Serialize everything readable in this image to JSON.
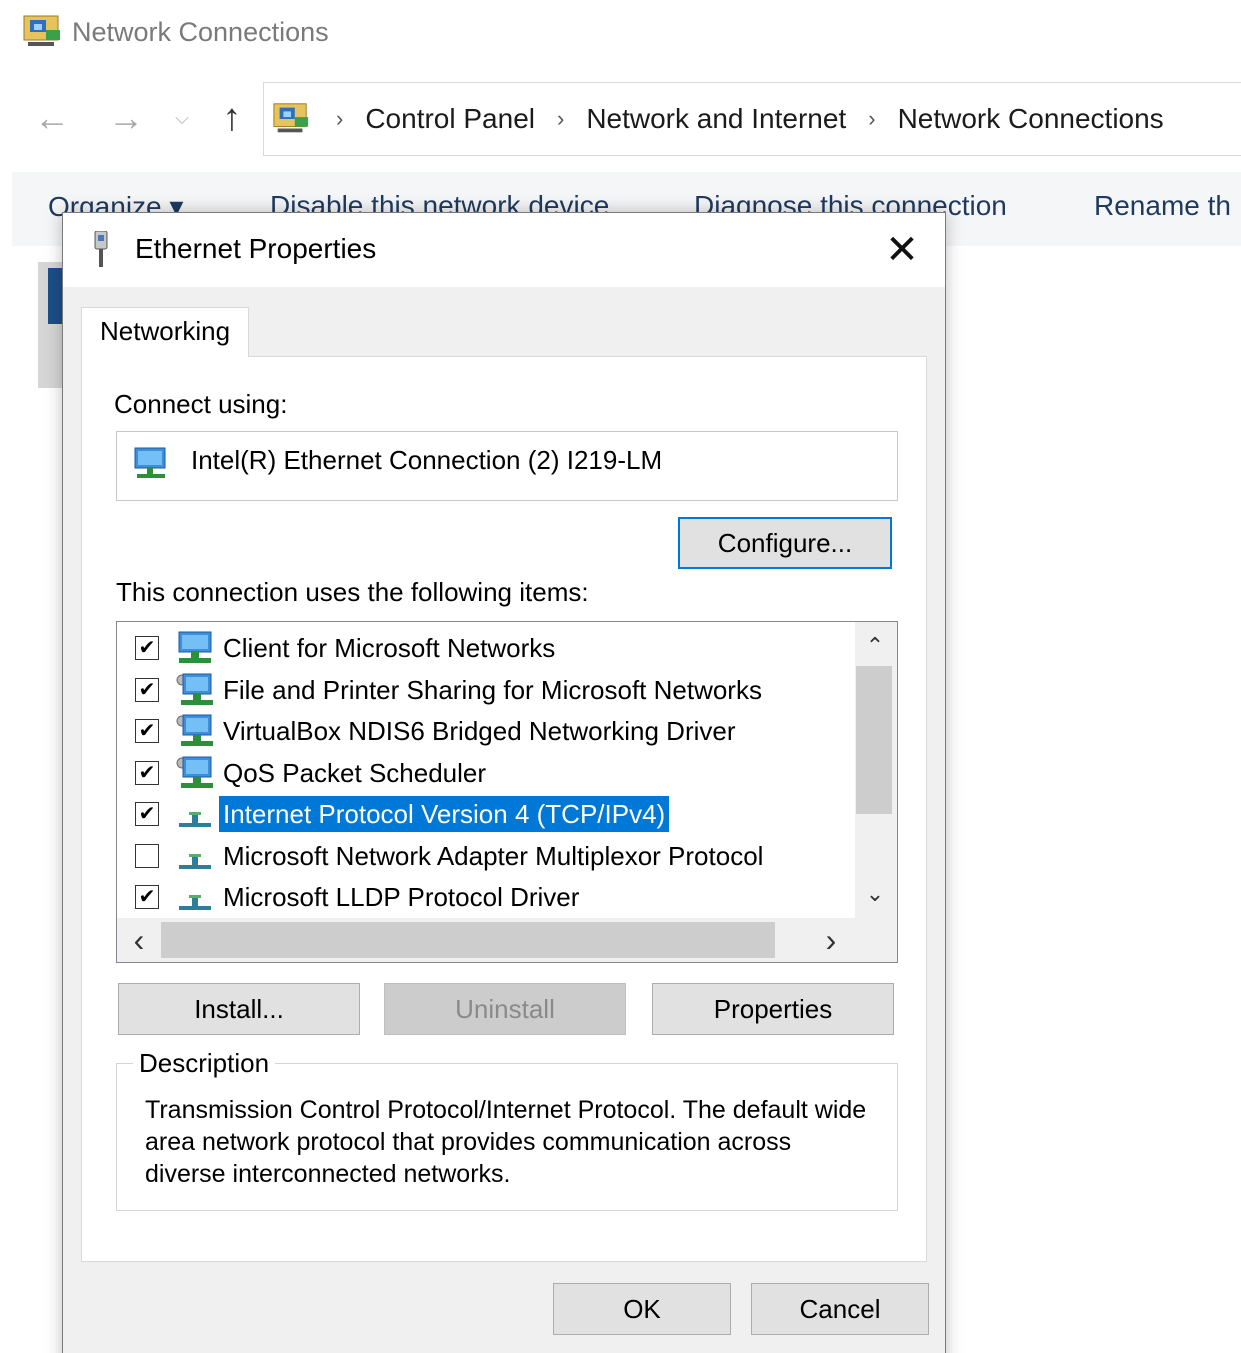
{
  "window": {
    "title": "Network Connections"
  },
  "address": {
    "crumbs": [
      "Control Panel",
      "Network and Internet",
      "Network Connections"
    ]
  },
  "nav_glyphs": {
    "back": "←",
    "forward": "→",
    "recent": "⌵",
    "up": "↑",
    "separator": "›"
  },
  "toolbar": {
    "organize": "Organize ▾",
    "disable": "Disable this network device",
    "diagnose": "Diagnose this connection",
    "rename": "Rename th"
  },
  "dialog": {
    "title": "Ethernet Properties",
    "close_glyph": "✕",
    "tab": "Networking",
    "connect_using_label": "Connect using:",
    "adapter_name": "Intel(R) Ethernet Connection (2) I219-LM",
    "configure_label": "Configure...",
    "items_label": "This connection uses the following items:",
    "items": [
      {
        "label": "Client for Microsoft Networks",
        "checked": true,
        "selected": false,
        "icon": "network-client-icon"
      },
      {
        "label": "File and Printer Sharing for Microsoft Networks",
        "checked": true,
        "selected": false,
        "icon": "network-service-icon"
      },
      {
        "label": "VirtualBox NDIS6 Bridged Networking Driver",
        "checked": true,
        "selected": false,
        "icon": "network-service-icon"
      },
      {
        "label": "QoS Packet Scheduler",
        "checked": true,
        "selected": false,
        "icon": "network-service-icon"
      },
      {
        "label": "Internet Protocol Version 4 (TCP/IPv4)",
        "checked": true,
        "selected": true,
        "icon": "protocol-icon"
      },
      {
        "label": "Microsoft Network Adapter Multiplexor Protocol",
        "checked": false,
        "selected": false,
        "icon": "protocol-icon"
      },
      {
        "label": "Microsoft LLDP Protocol Driver",
        "checked": true,
        "selected": false,
        "icon": "protocol-icon"
      }
    ],
    "scroll_glyphs": {
      "up": "⌃",
      "down": "⌄",
      "left": "‹",
      "right": "›"
    },
    "install_label": "Install...",
    "uninstall_label": "Uninstall",
    "properties_label": "Properties",
    "description_legend": "Description",
    "description_text": "Transmission Control Protocol/Internet Protocol. The default wide area network protocol that provides communication across diverse interconnected networks.",
    "ok_label": "OK",
    "cancel_label": "Cancel"
  },
  "colors": {
    "selection": "#0078d7",
    "focus_border": "#0078d7",
    "dialog_bg": "#f0f0f0"
  }
}
